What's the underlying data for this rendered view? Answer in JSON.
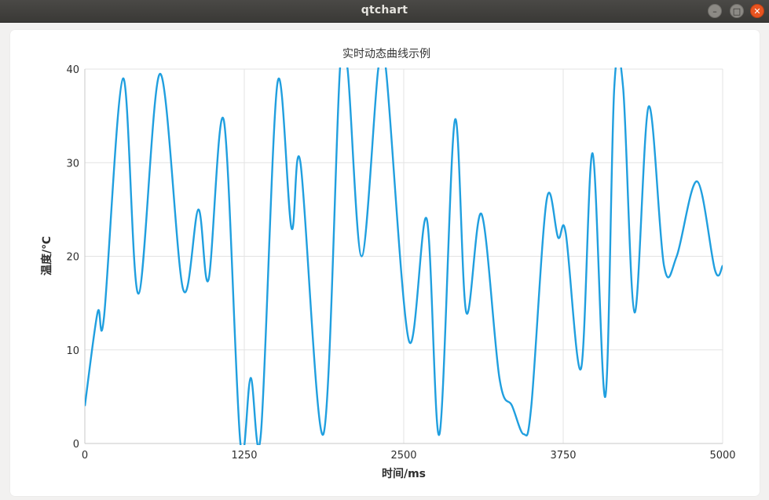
{
  "window": {
    "title": "qtchart",
    "minimize_icon": "minimize-icon",
    "maximize_icon": "maximize-icon",
    "close_icon": "close-icon"
  },
  "colors": {
    "series": "#209fdf",
    "grid": "#e3e3e3",
    "axis": "#c9c9c9",
    "close_button": "#e95420"
  },
  "chart_data": {
    "type": "line",
    "title": "实时动态曲线示例",
    "xlabel": "时间/ms",
    "ylabel": "温度/℃",
    "xlim": [
      0,
      5000
    ],
    "ylim": [
      0,
      40
    ],
    "x_ticks": [
      0,
      1250,
      2500,
      3750,
      5000
    ],
    "y_ticks": [
      0,
      10,
      20,
      30,
      40
    ],
    "grid": true,
    "legend": "none",
    "smooth": true,
    "series": [
      {
        "x": [
          0,
          100,
          150,
          300,
          420,
          590,
          770,
          890,
          970,
          1090,
          1220,
          1300,
          1380,
          1510,
          1620,
          1690,
          1870,
          2000,
          2060,
          2170,
          2300,
          2360,
          2540,
          2680,
          2780,
          2900,
          2990,
          3110,
          3250,
          3350,
          3440,
          3500,
          3620,
          3710,
          3770,
          3890,
          3980,
          4080,
          4150,
          4220,
          4310,
          4420,
          4540,
          4640,
          4800,
          4940,
          5000
        ],
        "values": [
          4,
          14,
          13.5,
          39,
          16,
          39.5,
          16.5,
          25,
          17.5,
          34.5,
          0,
          7,
          1,
          38.5,
          23,
          30,
          1,
          40,
          40,
          20,
          40,
          40,
          11,
          24,
          1,
          34.5,
          14,
          24.5,
          7,
          4,
          1,
          4,
          26,
          22,
          22.5,
          8,
          31,
          5,
          38,
          38,
          14,
          36,
          19,
          20,
          28,
          18.5,
          19
        ]
      }
    ]
  }
}
